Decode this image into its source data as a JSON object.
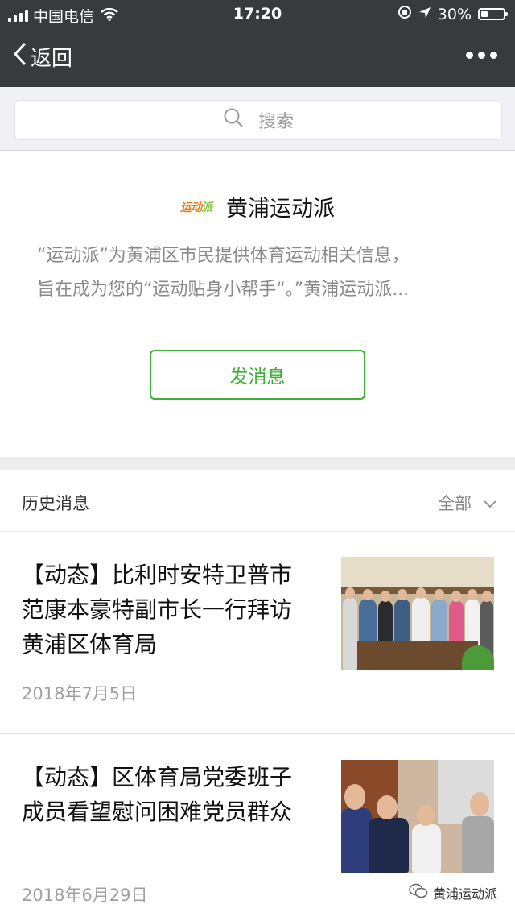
{
  "status_bar": {
    "carrier": "中国电信",
    "time": "17:20",
    "battery": "30%",
    "battery_level": 0.3
  },
  "nav": {
    "back_label": "返回"
  },
  "search": {
    "placeholder": "搜索"
  },
  "account": {
    "logo_text_a": "运动",
    "logo_text_b": "派",
    "name": "黄浦运动派",
    "description_line1": "“运动派”为黄浦区市民提供体育运动相关信息，",
    "description_line2": "旨在成为您的“运动贴身小帮手“。”黄浦运动派...",
    "send_message_label": "发消息"
  },
  "history": {
    "title": "历史消息",
    "filter_label": "全部",
    "articles": [
      {
        "title": "【动态】比利时安特卫普市范康本豪特副市长一行拜访黄浦区体育局",
        "date": "2018年7月5日"
      },
      {
        "title": "【动态】区体育局党委班子成员看望慰问困难党员群众",
        "date": "2018年6月29日"
      }
    ]
  },
  "watermark": {
    "text": "黄浦运动派"
  },
  "colors": {
    "bar": "#393a3e",
    "accent_green": "#3cb035"
  }
}
